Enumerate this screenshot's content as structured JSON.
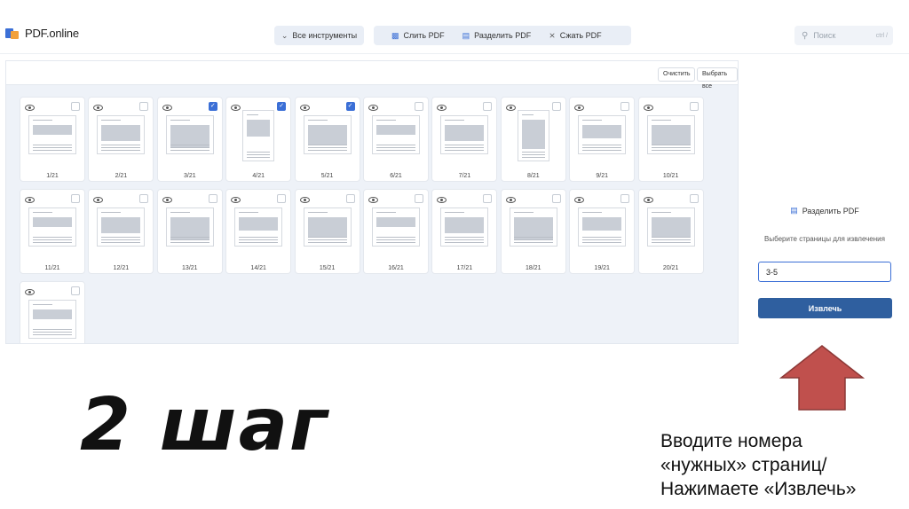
{
  "header": {
    "logo_text": "PDF.online",
    "tools_label": "Все инструменты",
    "tools_icon": "chevron-down-icon",
    "actions": [
      {
        "label": "Слить PDF",
        "icon": "merge-icon"
      },
      {
        "label": "Разделить PDF",
        "icon": "split-icon"
      },
      {
        "label": "Сжать PDF",
        "icon": "compress-icon"
      }
    ],
    "search_placeholder": "Поиск",
    "search_shortcut": "ctrl /"
  },
  "workspace": {
    "clear_label": "Очистить",
    "select_all_label": "Выбрать все",
    "pages": [
      {
        "label": "1/21",
        "checked": false
      },
      {
        "label": "2/21",
        "checked": false
      },
      {
        "label": "3/21",
        "checked": true
      },
      {
        "label": "4/21",
        "checked": true
      },
      {
        "label": "5/21",
        "checked": true
      },
      {
        "label": "6/21",
        "checked": false
      },
      {
        "label": "7/21",
        "checked": false
      },
      {
        "label": "8/21",
        "checked": false
      },
      {
        "label": "9/21",
        "checked": false
      },
      {
        "label": "10/21",
        "checked": false
      },
      {
        "label": "11/21",
        "checked": false
      },
      {
        "label": "12/21",
        "checked": false
      },
      {
        "label": "13/21",
        "checked": false
      },
      {
        "label": "14/21",
        "checked": false
      },
      {
        "label": "15/21",
        "checked": false
      },
      {
        "label": "16/21",
        "checked": false
      },
      {
        "label": "17/21",
        "checked": false
      },
      {
        "label": "18/21",
        "checked": false
      },
      {
        "label": "19/21",
        "checked": false
      },
      {
        "label": "20/21",
        "checked": false
      },
      {
        "label": "",
        "checked": false
      }
    ]
  },
  "panel": {
    "title": "Разделить PDF",
    "subtitle": "Выберите страницы для извлечения",
    "input_value": "3-5",
    "extract_label": "Извлечь"
  },
  "slide": {
    "step": "2 шаг",
    "instruction": [
      "Вводите номера",
      "«нужных» страниц/",
      "Нажимаете «Извлечь»"
    ],
    "arrow_color": "#c0504d"
  },
  "colors": {
    "accent": "#3b6fd6",
    "button": "#2f5f9f",
    "workspace_bg": "#eef2f8"
  }
}
